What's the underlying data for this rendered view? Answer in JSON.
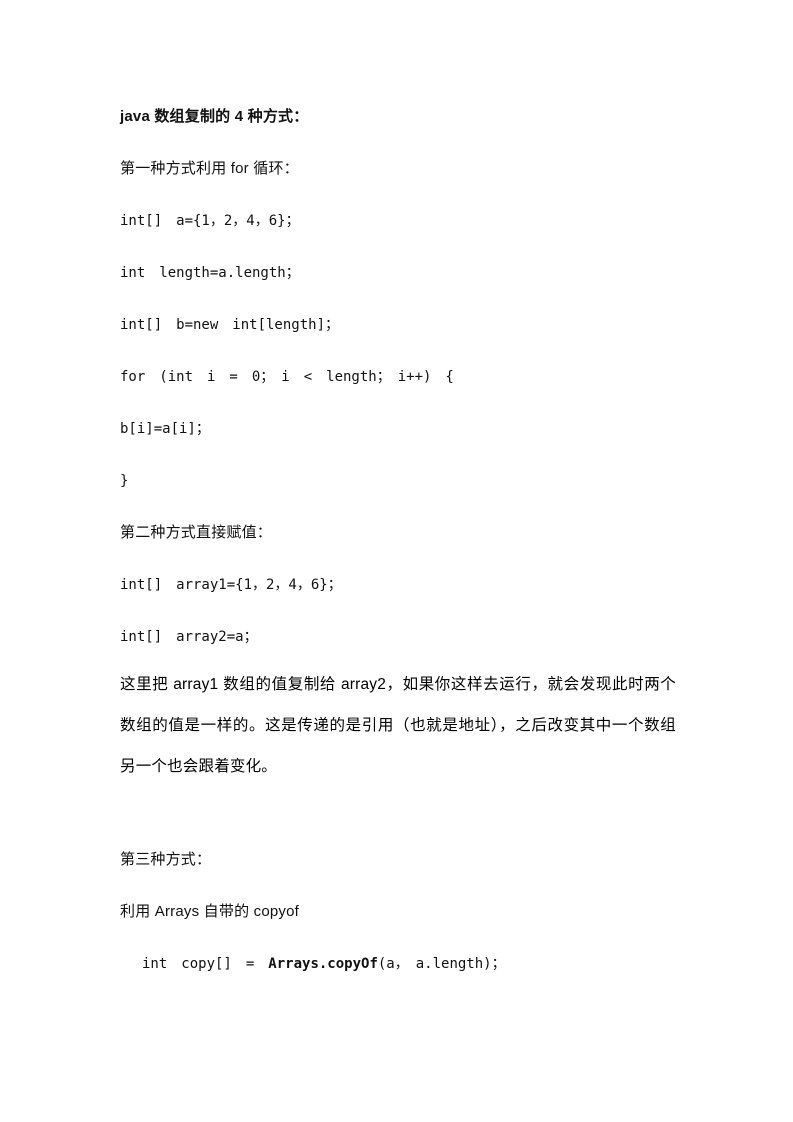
{
  "document": {
    "title": "java 数组复制的 4 种方式：",
    "sections": [
      {
        "heading": "第一种方式利用 for 循环：",
        "code_lines": [
          "int[]　a={1，2，4，6}；",
          "int　length=a.length；",
          "int[]　b=new　int[length]；",
          "for　(int　i　=　0；　i　<　length；　i++)　{",
          "b[i]=a[i]；",
          "}"
        ]
      },
      {
        "heading": "第二种方式直接赋值：",
        "code_lines": [
          "int[]　array1={1，2，4，6}；",
          "int[]　array2=a；"
        ],
        "paragraph": "这里把 array1 数组的值复制给 array2，如果你这样去运行，就会发现此时两个数组的值是一样的。这是传递的是引用（也就是地址），之后改变其中一个数组另一个也会跟着变化。"
      },
      {
        "heading": "第三种方式：",
        "subheading": "利用 Arrays 自带的 copyof",
        "code_final": {
          "prefix": "int　copy[]　=　",
          "emphasis": "Arrays.copyOf",
          "suffix": "(a，　a.length)；"
        }
      }
    ]
  },
  "colors": {
    "page_background": "#ffffff",
    "text": "#111111"
  }
}
